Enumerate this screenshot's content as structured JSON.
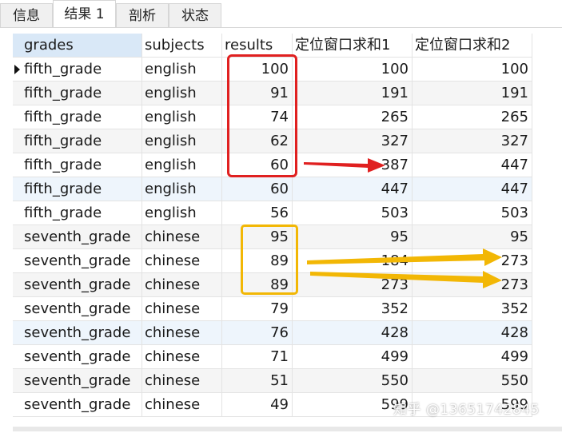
{
  "tabs": [
    "信息",
    "结果 1",
    "剖析",
    "状态"
  ],
  "active_tab": 1,
  "columns": [
    "grades",
    "subjects",
    "results",
    "定位窗口求和1",
    "定位窗口求和2"
  ],
  "rows": [
    [
      "fifth_grade",
      "english",
      "100",
      "100",
      "100"
    ],
    [
      "fifth_grade",
      "english",
      "91",
      "191",
      "191"
    ],
    [
      "fifth_grade",
      "english",
      "74",
      "265",
      "265"
    ],
    [
      "fifth_grade",
      "english",
      "62",
      "327",
      "327"
    ],
    [
      "fifth_grade",
      "english",
      "60",
      "387",
      "447"
    ],
    [
      "fifth_grade",
      "english",
      "60",
      "447",
      "447"
    ],
    [
      "fifth_grade",
      "english",
      "56",
      "503",
      "503"
    ],
    [
      "seventh_grade",
      "chinese",
      "95",
      "95",
      "95"
    ],
    [
      "seventh_grade",
      "chinese",
      "89",
      "184",
      "273"
    ],
    [
      "seventh_grade",
      "chinese",
      "89",
      "273",
      "273"
    ],
    [
      "seventh_grade",
      "chinese",
      "79",
      "352",
      "352"
    ],
    [
      "seventh_grade",
      "chinese",
      "76",
      "428",
      "428"
    ],
    [
      "seventh_grade",
      "chinese",
      "71",
      "499",
      "499"
    ],
    [
      "seventh_grade",
      "chinese",
      "51",
      "550",
      "550"
    ],
    [
      "seventh_grade",
      "chinese",
      "49",
      "599",
      "599"
    ]
  ],
  "watermark": "知乎 @13651742845",
  "colors": {
    "red_annotation": "#e02020",
    "yellow_annotation": "#f2b705",
    "header_selected": "#d9e8f7"
  }
}
